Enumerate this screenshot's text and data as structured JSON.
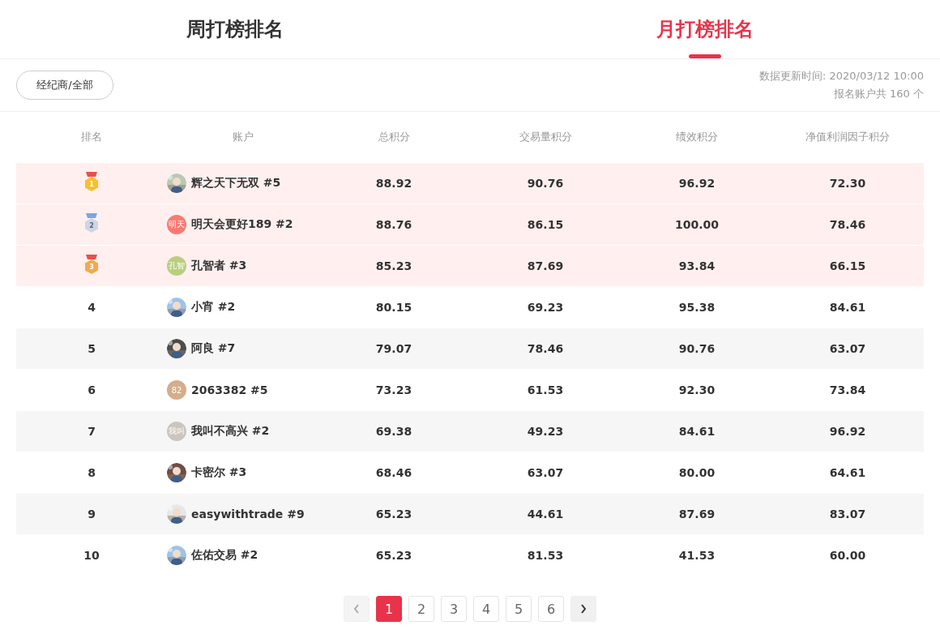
{
  "tabs": [
    {
      "label": "周打榜排名",
      "selected": false
    },
    {
      "label": "月打榜排名",
      "selected": true
    }
  ],
  "filter": {
    "label": "经纪商/全部"
  },
  "update_time": "数据更新时间: 2020/03/12 10:00",
  "total_accounts": "报名账户共 160 个",
  "table": {
    "columns": [
      "排名",
      "账户",
      "总积分",
      "交易量积分",
      "绩效积分",
      "净值利润因子积分"
    ],
    "rows": [
      {
        "rank": "1",
        "kind": "gold",
        "account": "辉之天下无双 #5",
        "values": [
          "88.92",
          "90.76",
          "96.92",
          "72.30"
        ]
      },
      {
        "rank": "2",
        "kind": "silver",
        "avatar": {
          "kind": "text",
          "text": "明天",
          "color": "#f87a72"
        },
        "account": "明天会更好189 #2",
        "values": [
          "88.76",
          "86.15",
          "100.00",
          "78.46"
        ]
      },
      {
        "rank": "3",
        "kind": "bronze",
        "avatar": {
          "kind": "text",
          "text": "孔智",
          "color": "#b9cf7f"
        },
        "account": "孔智者 #3",
        "values": [
          "85.23",
          "87.69",
          "93.84",
          "66.15"
        ]
      },
      {
        "rank": "4",
        "kind": "plain",
        "account": "小宵 #2",
        "values": [
          "80.15",
          "69.23",
          "95.38",
          "84.61"
        ]
      },
      {
        "rank": "5",
        "kind": "plain",
        "account": "阿良 #7",
        "values": [
          "79.07",
          "78.46",
          "90.76",
          "63.07"
        ]
      },
      {
        "rank": "6",
        "kind": "plain",
        "avatar": {
          "kind": "text",
          "text": "82",
          "color": "#d5ad8a"
        },
        "account": "2063382 #5",
        "values": [
          "73.23",
          "61.53",
          "92.30",
          "73.84"
        ]
      },
      {
        "rank": "7",
        "kind": "plain",
        "avatar": {
          "kind": "text",
          "text": "我叫",
          "color": "#cdc5bd"
        },
        "account": "我叫不高兴 #2",
        "values": [
          "69.38",
          "49.23",
          "84.61",
          "96.92"
        ]
      },
      {
        "rank": "8",
        "kind": "plain",
        "account": "卡密尔 #3",
        "values": [
          "68.46",
          "63.07",
          "80.00",
          "64.61"
        ]
      },
      {
        "rank": "9",
        "kind": "plain",
        "account": "easywithtrade #9",
        "values": [
          "65.23",
          "44.61",
          "87.69",
          "83.07"
        ]
      },
      {
        "rank": "10",
        "kind": "plain",
        "account": "佐佑交易 #2",
        "values": [
          "65.23",
          "81.53",
          "41.53",
          "60.00"
        ]
      }
    ]
  },
  "pagination": {
    "pages": [
      {
        "label": "1",
        "selected": true
      },
      {
        "label": "2",
        "selected": false
      },
      {
        "label": "3",
        "selected": false
      },
      {
        "label": "4",
        "selected": false
      },
      {
        "label": "5",
        "selected": false
      },
      {
        "label": "6",
        "selected": false
      }
    ],
    "prev_disabled": true
  }
}
